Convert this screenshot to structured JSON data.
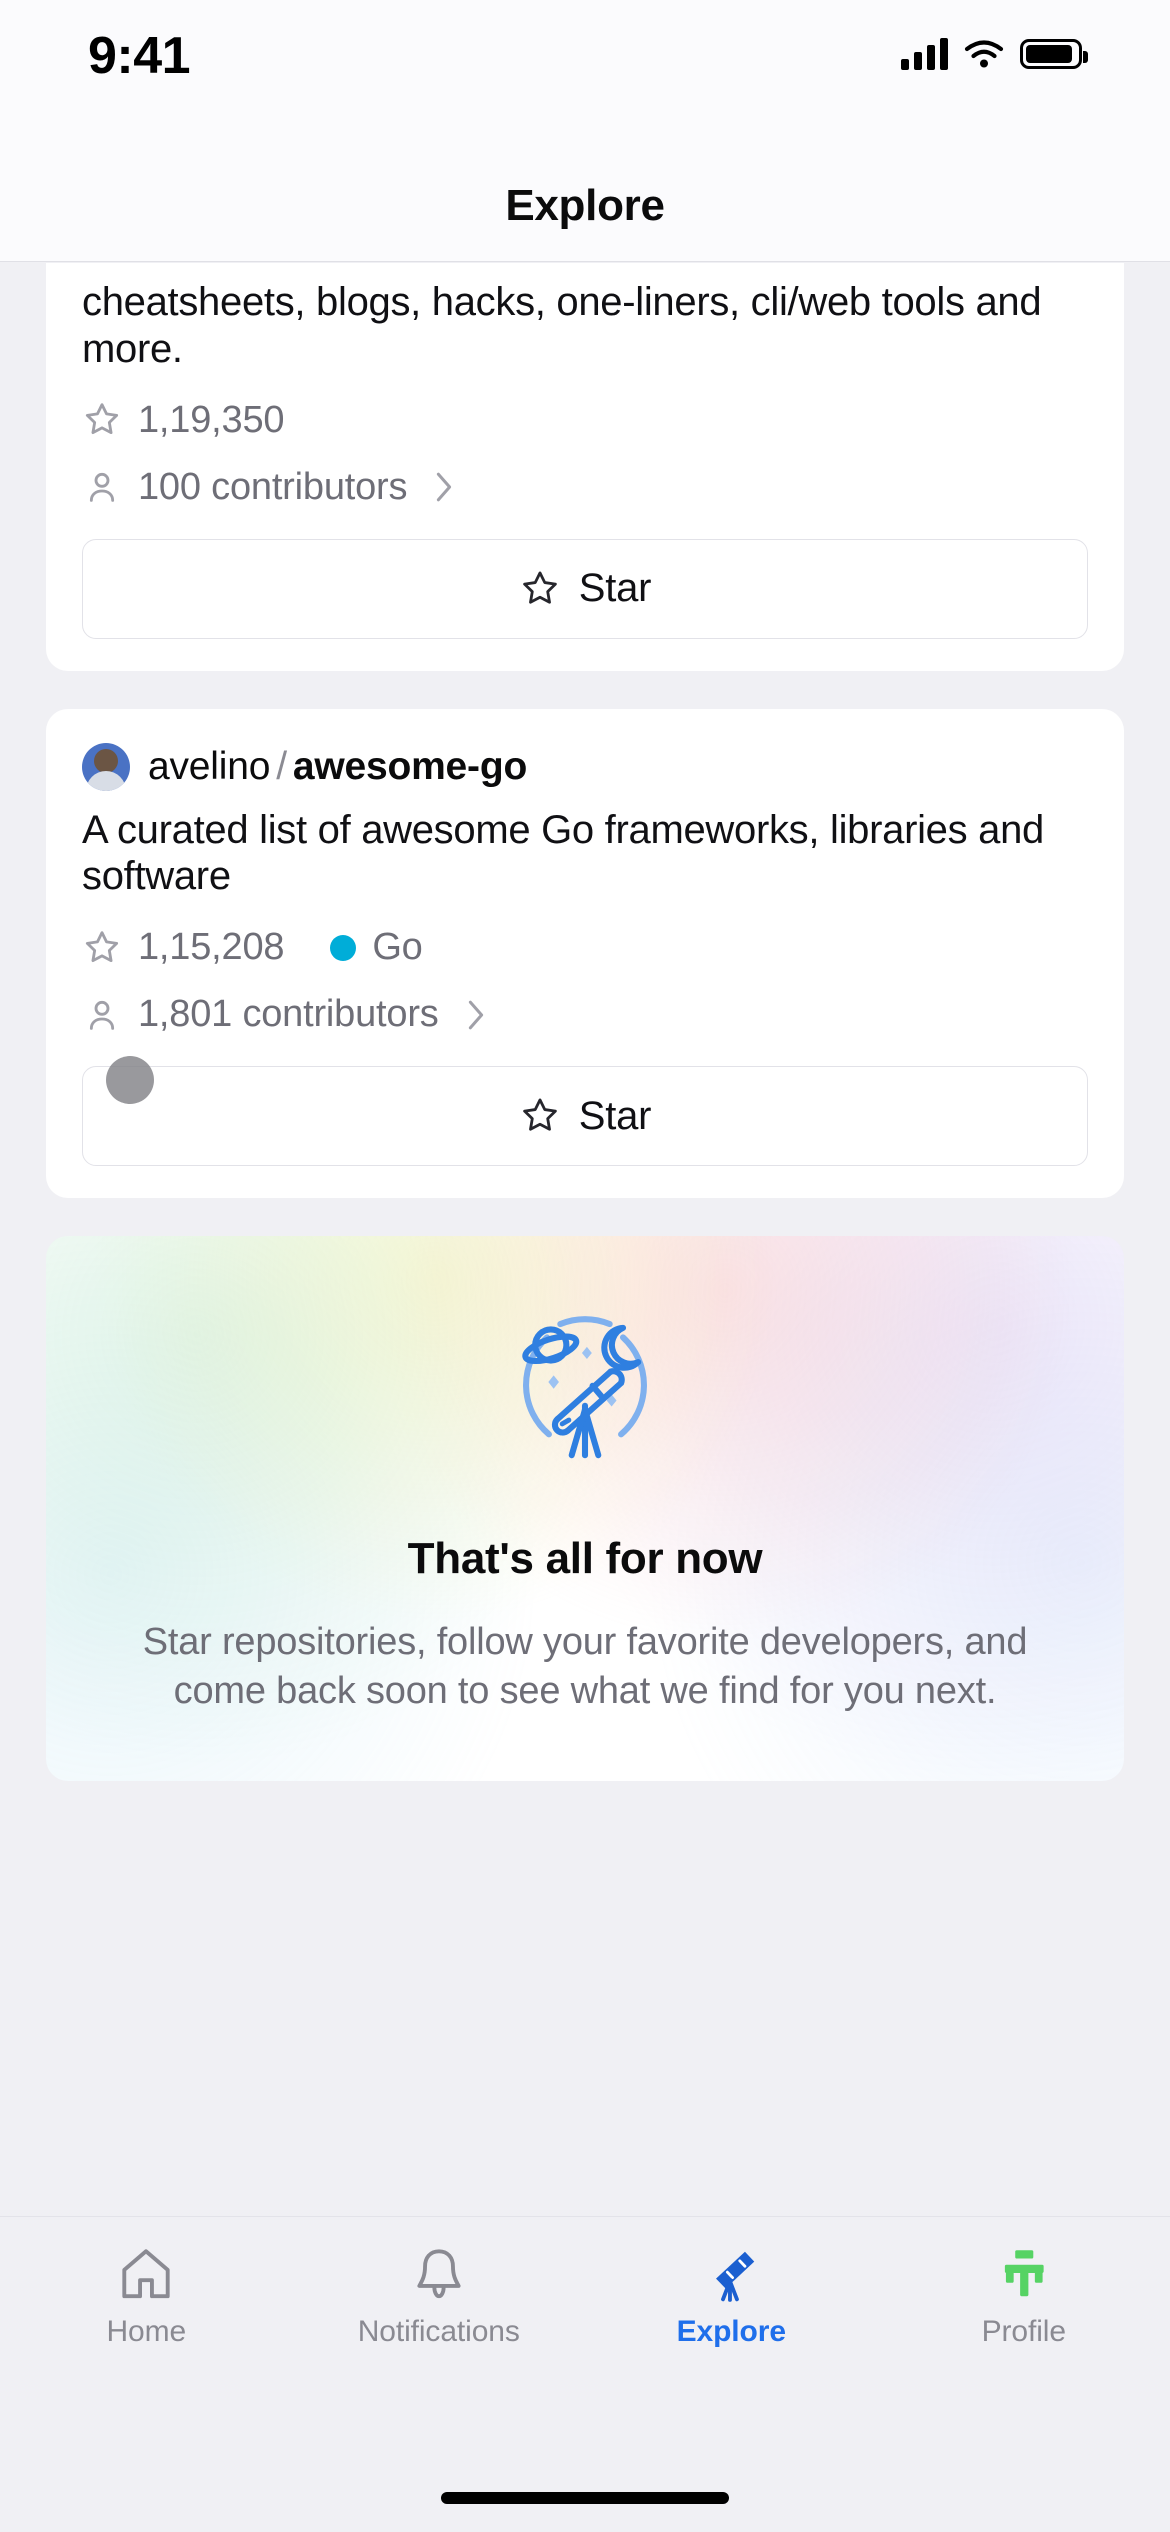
{
  "status_bar": {
    "time": "9:41",
    "cellular_icon": "signal-bars-icon",
    "wifi_icon": "wifi-icon",
    "battery_icon": "battery-full-icon"
  },
  "header": {
    "title": "Explore"
  },
  "repositories": [
    {
      "description": "cheatsheets, blogs, hacks, one-liners, cli/web tools and more.",
      "stars": "1,19,350",
      "star_icon": "star-outline-icon",
      "contributors": "100 contributors",
      "contributors_icon": "person-icon",
      "chevron_icon": "chevron-right-icon",
      "language": null,
      "language_color": null,
      "star_button_label": "Star",
      "partial": true
    },
    {
      "owner": "avelino",
      "separator": "/",
      "name": "awesome-go",
      "avatar_icon": "user-avatar",
      "description": "A curated list of awesome Go frameworks, libraries and software",
      "stars": "1,15,208",
      "star_icon": "star-outline-icon",
      "language": "Go",
      "language_color": "#00ADD8",
      "contributors": "1,801 contributors",
      "contributors_icon": "person-icon",
      "chevron_icon": "chevron-right-icon",
      "star_button_label": "Star",
      "partial": false
    }
  ],
  "empty_state": {
    "illustration_icon": "telescope-illustration",
    "title": "That's all for now",
    "subtitle": "Star repositories, follow your favorite developers, and come back soon to see what we find for you next."
  },
  "tab_bar": {
    "items": [
      {
        "label": "Home",
        "icon": "home-icon",
        "active": false
      },
      {
        "label": "Notifications",
        "icon": "bell-icon",
        "active": false
      },
      {
        "label": "Explore",
        "icon": "telescope-icon",
        "active": true
      },
      {
        "label": "Profile",
        "icon": "profile-icon",
        "active": false
      }
    ],
    "active_color": "#1f6feb",
    "inactive_color": "#8a8a92",
    "profile_icon_color": "#56d364"
  },
  "home_indicator": "home-indicator"
}
